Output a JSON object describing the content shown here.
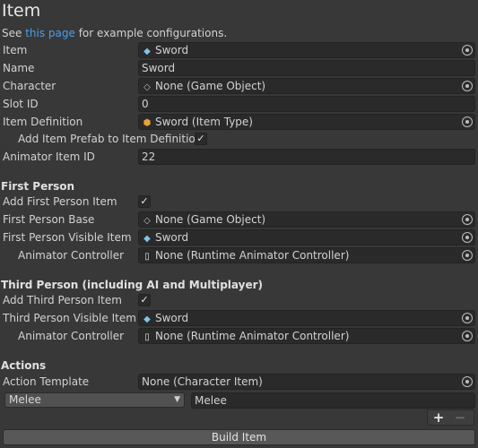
{
  "header": {
    "title": "Item",
    "help_prefix": "See ",
    "help_link": "this page",
    "help_suffix": " for example configurations."
  },
  "fields": {
    "item": {
      "label": "Item",
      "value": "Sword"
    },
    "name": {
      "label": "Name",
      "value": "Sword"
    },
    "character": {
      "label": "Character",
      "value": "None (Game Object)"
    },
    "slot_id": {
      "label": "Slot ID",
      "value": "0"
    },
    "item_definition": {
      "label": "Item Definition",
      "value": "Sword (Item Type)"
    },
    "add_prefab_to_definition": {
      "label": "Add Item Prefab to Item Definition",
      "checked": true
    },
    "animator_item_id": {
      "label": "Animator Item ID",
      "value": "22"
    }
  },
  "first_person": {
    "heading": "First Person",
    "add_label": "Add First Person Item",
    "add_checked": true,
    "base_label": "First Person Base",
    "base_value": "None (Game Object)",
    "visible_label": "First Person Visible Item",
    "visible_value": "Sword",
    "animator_label": "Animator Controller",
    "animator_value": "None (Runtime Animator Controller)"
  },
  "third_person": {
    "heading": "Third Person (including AI and Multiplayer)",
    "add_label": "Add Third Person Item",
    "add_checked": true,
    "visible_label": "Third Person Visible Item",
    "visible_value": "Sword",
    "animator_label": "Animator Controller",
    "animator_value": "None (Runtime Animator Controller)"
  },
  "actions": {
    "heading": "Actions",
    "template_label": "Action Template",
    "template_value": "None (Character Item)",
    "type_selected": "Melee",
    "name_value": "Melee",
    "add_label": "+",
    "remove_label": "−"
  },
  "build_button": "Build Item",
  "checkmark": "✓",
  "colors": {
    "background": "#383838",
    "field": "#2a2a2a",
    "link": "#4c9ee8",
    "button": "#585858"
  },
  "icons": {
    "item": "item-cube-icon",
    "game_object": "game-object-icon",
    "item_type": "item-type-icon",
    "animator": "document-icon"
  }
}
